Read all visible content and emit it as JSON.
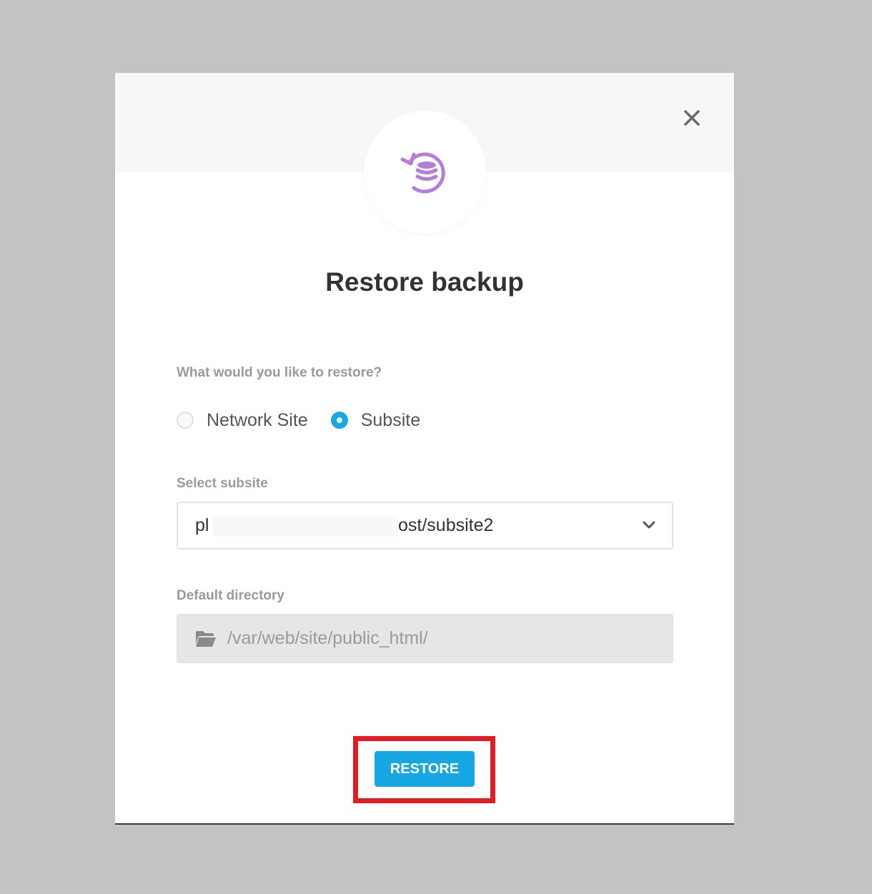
{
  "modal": {
    "title": "Restore backup",
    "close_icon": "close-icon",
    "header_icon": "restore-backup-icon",
    "accent_color": "#b57edc"
  },
  "restore_type": {
    "question": "What would you like to restore?",
    "options": [
      {
        "label": "Network Site",
        "checked": false
      },
      {
        "label": "Subsite",
        "checked": true
      }
    ],
    "checked_color": "#17a8e3"
  },
  "subsite": {
    "label": "Select subsite",
    "value_prefix": "pl",
    "value_suffix": "ost/subsite2",
    "icon": "chevron-down-icon"
  },
  "directory": {
    "label": "Default directory",
    "value": "/var/web/site/public_html/",
    "icon": "folder-icon"
  },
  "actions": {
    "restore_label": "RESTORE",
    "button_color": "#17a8e3",
    "highlight_color": "#e31b23"
  }
}
